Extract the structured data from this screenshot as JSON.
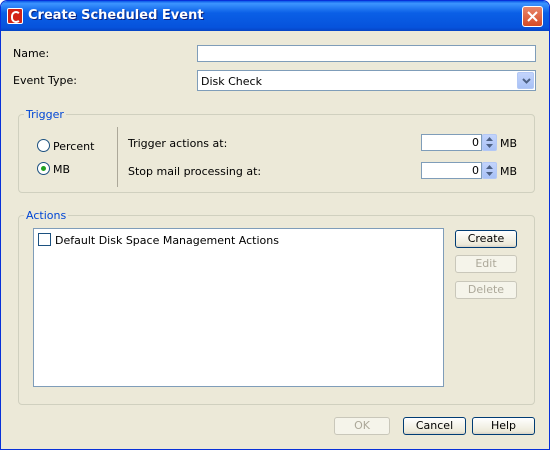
{
  "window": {
    "title": "Create Scheduled Event",
    "accent": "#0054e3"
  },
  "form": {
    "name_label": "Name:",
    "name_value": "",
    "event_type_label": "Event Type:",
    "event_type_value": "Disk Check"
  },
  "trigger": {
    "legend": "Trigger",
    "units": [
      {
        "label": "Percent",
        "selected": false
      },
      {
        "label": "MB",
        "selected": true
      }
    ],
    "trigger_actions_label": "Trigger actions at:",
    "trigger_actions_value": "0",
    "trigger_actions_unit": "MB",
    "stop_mail_label": "Stop mail processing at:",
    "stop_mail_value": "0",
    "stop_mail_unit": "MB"
  },
  "actions": {
    "legend": "Actions",
    "items": [
      {
        "label": "Default Disk Space Management Actions",
        "checked": false
      }
    ],
    "create_label": "Create",
    "edit_label": "Edit",
    "delete_label": "Delete"
  },
  "footer": {
    "ok_label": "OK",
    "cancel_label": "Cancel",
    "help_label": "Help"
  },
  "icons": {
    "app": "app-logo-icon",
    "close": "close-icon",
    "dropdown": "chevron-down-icon",
    "spin_up": "spin-up-icon",
    "spin_down": "spin-down-icon"
  }
}
